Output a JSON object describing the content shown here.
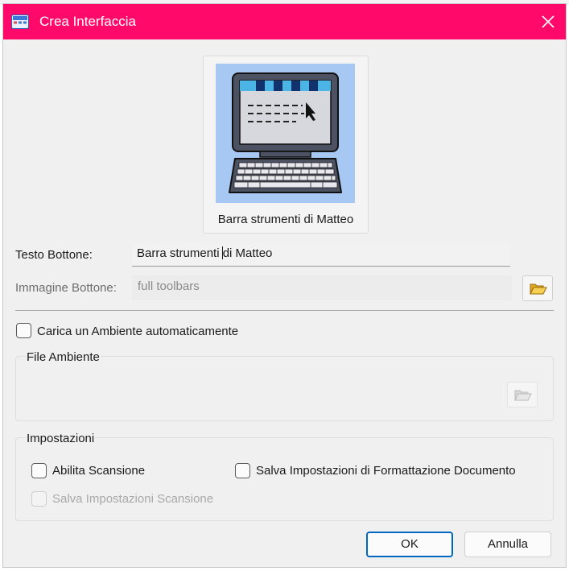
{
  "window": {
    "title": "Crea Interfaccia",
    "accent_color": "#ff0a6b",
    "icons": {
      "app": "toolbar-app-icon",
      "close": "close-icon"
    }
  },
  "preview": {
    "label": "Barra  strumenti di Matteo",
    "image": "computer-screen-keyboard-symbol"
  },
  "fields": {
    "button_text_label": "Testo Bottone:",
    "button_text_value_before": "Barra  strumenti ",
    "button_text_value_after": "di Matteo",
    "button_image_label": "Immagine Bottone:",
    "button_image_value": "full toolbars",
    "browse_icon": "open-folder-icon"
  },
  "environment": {
    "auto_load_label": "Carica un Ambiente automaticamente",
    "auto_load_checked": false,
    "file_group_title": "File Ambiente"
  },
  "settings": {
    "group_title": "Impostazioni",
    "enable_scan_label": "Abilita Scansione",
    "enable_scan_checked": false,
    "save_format_label": "Salva Impostazioni di Formattazione Documento",
    "save_format_checked": false,
    "save_scan_label": "Salva Impostazioni Scansione",
    "save_scan_checked": false
  },
  "buttons": {
    "ok": "OK",
    "cancel": "Annulla"
  }
}
